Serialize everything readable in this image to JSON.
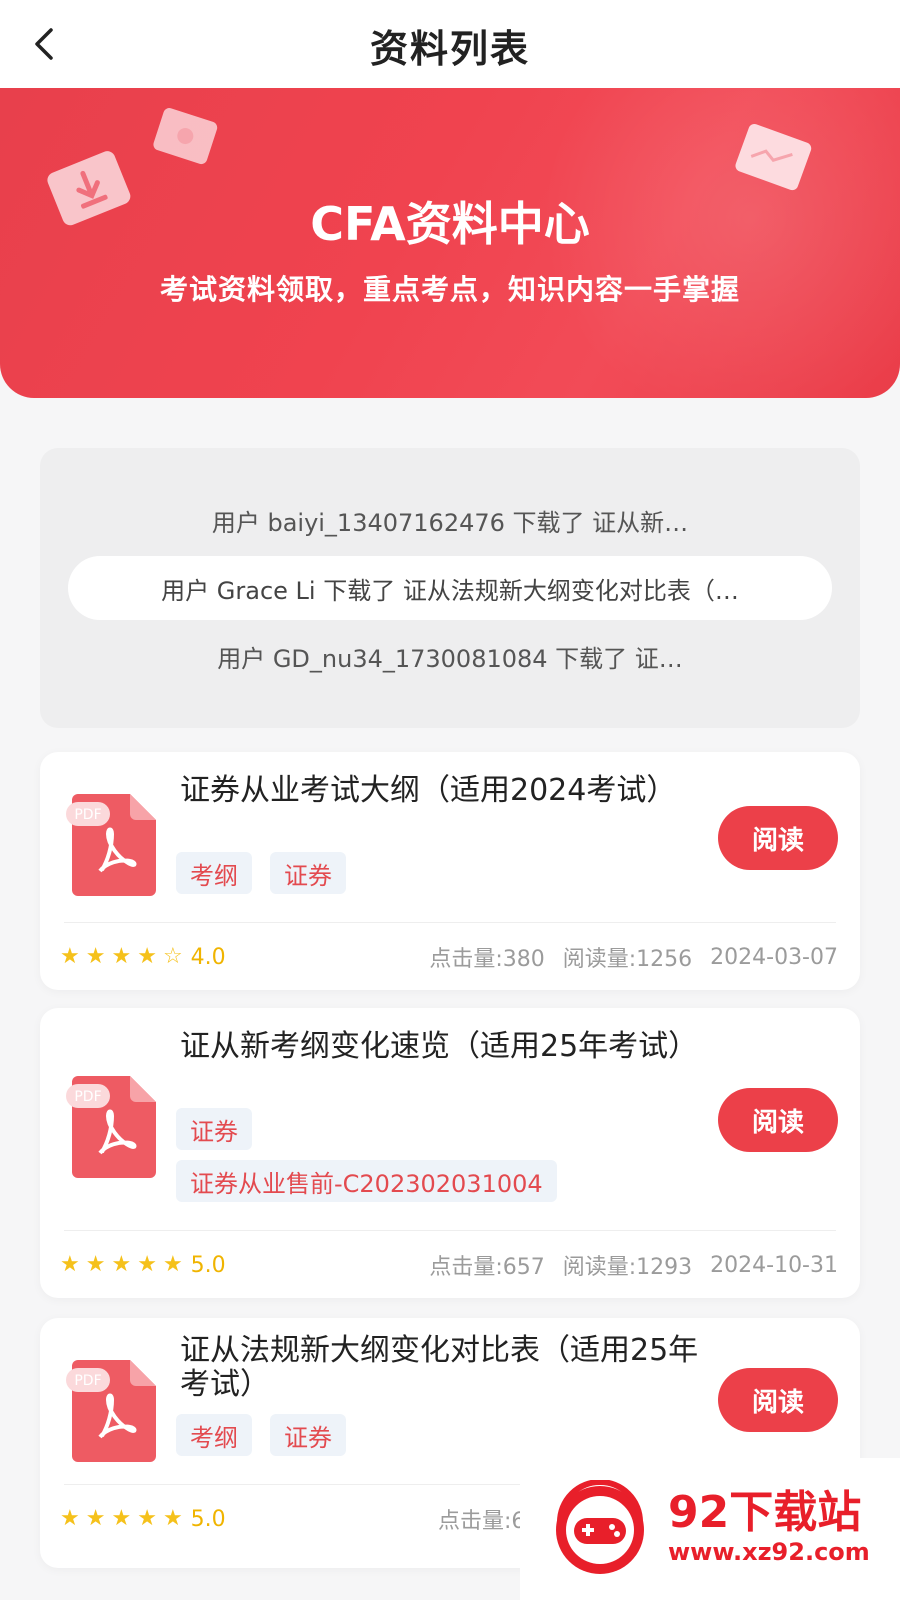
{
  "header": {
    "title": "资料列表"
  },
  "banner": {
    "title": "CFA资料中心",
    "subtitle": "考试资料领取，重点考点，知识内容一手掌握"
  },
  "ticker": {
    "lines": [
      "用户 baiyi_13407162476 下载了 证从新…",
      "用户 Grace Li 下载了 证从法规新大纲变化对比表（…",
      "用户 GD_nu34_1730081084 下载了 证…"
    ]
  },
  "documents": [
    {
      "title": "证券从业考试大纲（适用2024考试）",
      "tags": [
        "考纲",
        "证券"
      ],
      "read_label": "阅读",
      "rating": "4.0",
      "stars": 4,
      "clicks": "点击量:380",
      "reads": "阅读量:1256",
      "date": "2024-03-07"
    },
    {
      "title": "证从新考纲变化速览（适用25年考试）",
      "tags": [
        "证券",
        "证券从业售前-C202302031004"
      ],
      "read_label": "阅读",
      "rating": "5.0",
      "stars": 5,
      "clicks": "点击量:657",
      "reads": "阅读量:1293",
      "date": "2024-10-31"
    },
    {
      "title": "证从法规新大纲变化对比表（适用25年考试）",
      "tags": [
        "考纲",
        "证券"
      ],
      "read_label": "阅读",
      "rating": "5.0",
      "stars": 5,
      "clicks": "点击量:6",
      "reads": "",
      "date": ""
    }
  ],
  "pdf_label": "PDF",
  "watermark": {
    "name": "92下载站",
    "url": "www.xz92.com"
  },
  "colors": {
    "primary": "#ec4049",
    "star": "#f5c11b",
    "tag_text": "#e34a4f"
  }
}
